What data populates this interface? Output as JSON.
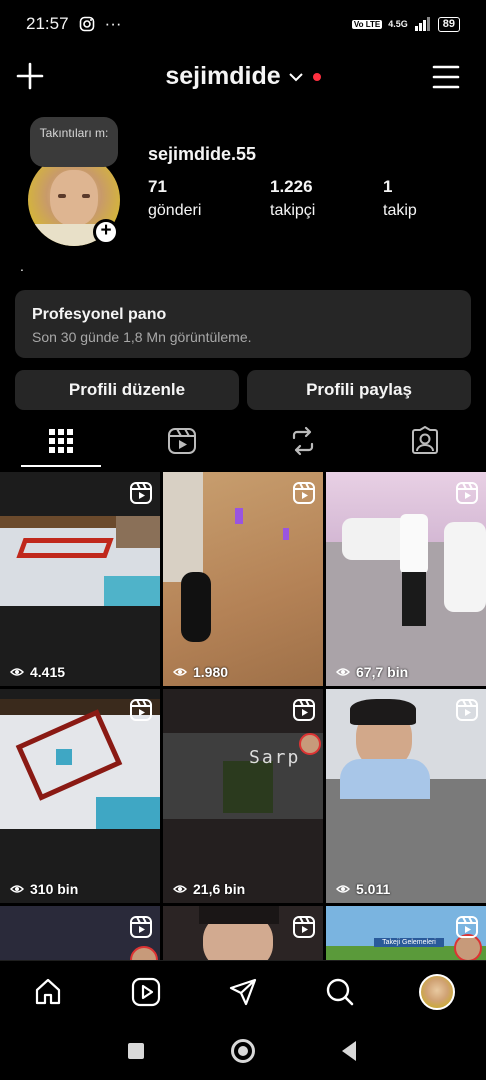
{
  "status_bar": {
    "time": "21:57",
    "network": "4.5G",
    "battery": "89",
    "volte": "Vo LTE",
    "more": "···"
  },
  "header": {
    "account_name": "sejimdide"
  },
  "note": {
    "text": "Takıntıları m:"
  },
  "profile": {
    "display_username": "sejimdide.55",
    "posts_count": "71",
    "posts_label": "gönderi",
    "followers_count": "1.226",
    "followers_label": "takipçi",
    "following_count": "1",
    "following_label": "takip",
    "bio": "."
  },
  "pro_panel": {
    "title": "Profesyonel pano",
    "subtitle": "Son 30 günde 1,8 Mn görüntüleme."
  },
  "buttons": {
    "edit_profile": "Profili düzenle",
    "share_profile": "Profili paylaş"
  },
  "tabs": [
    {
      "icon": "grid-icon",
      "active": true
    },
    {
      "icon": "reels-icon",
      "active": false
    },
    {
      "icon": "reposts-icon",
      "active": false
    },
    {
      "icon": "tagged-icon",
      "active": false
    }
  ],
  "grid": [
    {
      "views": "4.415",
      "thumb": "minecraft-arena"
    },
    {
      "views": "1.980",
      "thumb": "game-dance"
    },
    {
      "views": "67,7 bin",
      "thumb": "street-man"
    },
    {
      "views": "310 bin",
      "thumb": "minecraft-arena"
    },
    {
      "views": "21,6 bin",
      "thumb": "minecraft-cave"
    },
    {
      "views": "5.011",
      "thumb": "webcam-man"
    },
    {
      "views": "",
      "thumb": "partial"
    },
    {
      "views": "",
      "thumb": "partial"
    },
    {
      "views": "",
      "thumb": "partial"
    }
  ],
  "grid_overlay_texts": {
    "cell5": "Sarp",
    "cell9": "Takeji Gelemeleri"
  },
  "bottom_nav": [
    "home-icon",
    "reels-icon",
    "send-icon",
    "search-icon",
    "profile-avatar"
  ],
  "colors": {
    "background": "#000000",
    "panel": "#262626",
    "notification_dot": "#ff3040"
  }
}
